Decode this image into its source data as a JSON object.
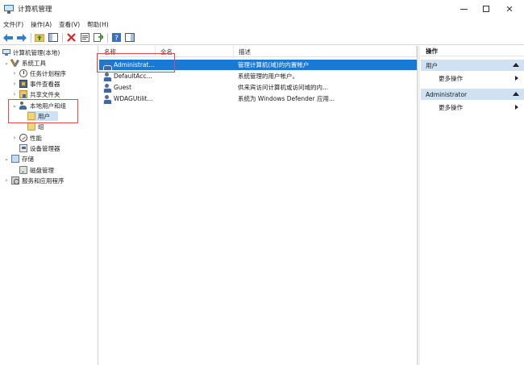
{
  "window": {
    "title": "计算机管理",
    "min_symbol": "—",
    "close_symbol": "✕"
  },
  "menu": [
    "文件(F)",
    "操作(A)",
    "查看(V)",
    "帮助(H)"
  ],
  "toolbar_icons": [
    "back-arrow-icon",
    "forward-arrow-icon",
    "up-folder-icon",
    "show-hide-tree-icon",
    "delete-icon",
    "properties-icon",
    "export-list-icon",
    "help-icon",
    "show-hide-action-pane-icon"
  ],
  "tree": {
    "root": "计算机管理(本地)",
    "system_tools": "系统工具",
    "task_scheduler": "任务计划程序",
    "event_viewer": "事件查看器",
    "shared_folders": "共享文件夹",
    "local_users_groups": "本地用户和组",
    "users": "用户",
    "groups": "组",
    "performance": "性能",
    "device_manager": "设备管理器",
    "storage": "存储",
    "disk_management": "磁盘管理",
    "services_apps": "服务和应用程序"
  },
  "list": {
    "columns": {
      "name": "名称",
      "fullname": "全名",
      "description": "描述"
    },
    "rows": [
      {
        "name": "Administrat...",
        "fullname": "",
        "description": "管理计算机(域)的内置帐户"
      },
      {
        "name": "DefaultAcc...",
        "fullname": "",
        "description": "系统管理的用户帐户。"
      },
      {
        "name": "Guest",
        "fullname": "",
        "description": "供来宾访问计算机或访问域的内..."
      },
      {
        "name": "WDAGUtilit...",
        "fullname": "",
        "description": "系统为 Windows Defender 应用..."
      }
    ]
  },
  "actions": {
    "title": "操作",
    "section1": "用户",
    "more1": "更多操作",
    "section2": "Administrator",
    "more2": "更多操作"
  },
  "colors": {
    "selection": "#1979d6",
    "tree_selection": "#cde2f7",
    "action_header": "#cfe1f3",
    "highlight_box": "#e84a4a"
  }
}
